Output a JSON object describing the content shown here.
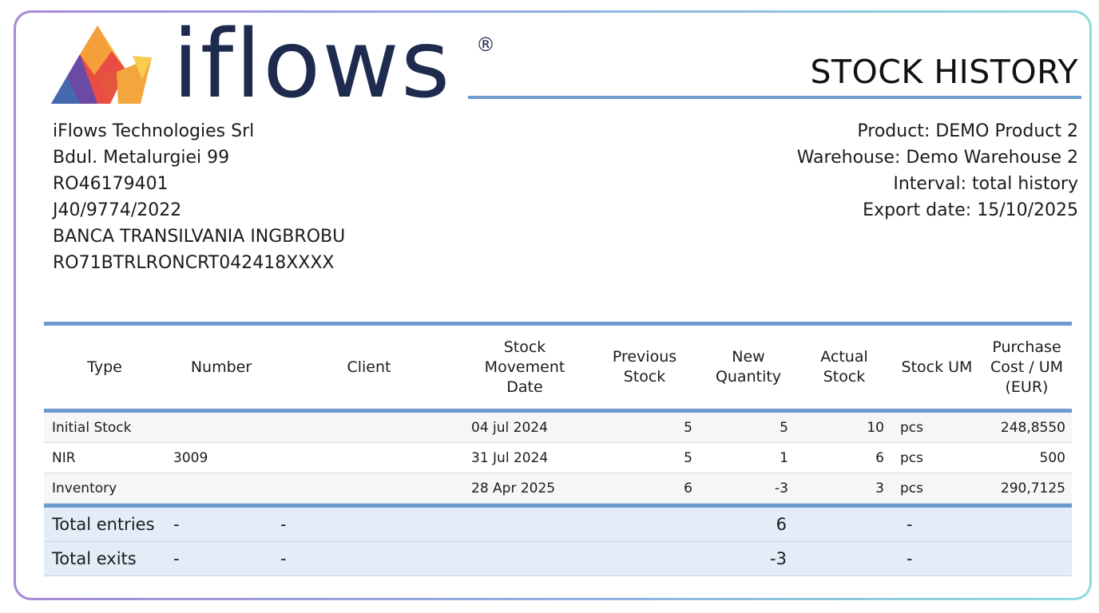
{
  "brand": {
    "wordmark": "iflows",
    "registered_mark": "®",
    "colors": {
      "navy": "#1e2b4f",
      "accent_blue": "#6d9bce",
      "total_row_bg": "#e3edf8"
    }
  },
  "document": {
    "title": "STOCK HISTORY"
  },
  "company": {
    "lines": [
      "iFlows Technologies Srl",
      "Bdul. Metalurgiei 99",
      "RO46179401",
      "J40/9774/2022",
      "BANCA TRANSILVANIA INGBROBU",
      "RO71BTRLRONCRT042418XXXX"
    ]
  },
  "meta": {
    "lines": [
      "Product: DEMO Product 2",
      "Warehouse: Demo Warehouse 2",
      "Interval: total history",
      "Export date: 15/10/2025"
    ]
  },
  "table": {
    "headers": {
      "type": "Type",
      "number": "Number",
      "client": "Client",
      "date_1": "Stock",
      "date_2": "Movement",
      "date_3": "Date",
      "prev_1": "Previous",
      "prev_2": "Stock",
      "newq_1": "New",
      "newq_2": "Quantity",
      "actual_1": "Actual",
      "actual_2": "Stock",
      "um": "Stock UM",
      "cost_1": "Purchase",
      "cost_2": "Cost / UM",
      "cost_3": "(EUR)"
    },
    "rows": [
      {
        "type": "Initial Stock",
        "number": "",
        "client": "",
        "date": "04 jul 2024",
        "previous": "5",
        "new_qty": "5",
        "actual": "10",
        "um": "pcs",
        "cost": "248,8550"
      },
      {
        "type": "NIR",
        "number": "3009",
        "client": "",
        "date": "31 Jul 2024",
        "previous": "5",
        "new_qty": "1",
        "actual": "6",
        "um": "pcs",
        "cost": "500"
      },
      {
        "type": "Inventory",
        "number": "",
        "client": "",
        "date": "28 Apr 2025",
        "previous": "6",
        "new_qty": "-3",
        "actual": "3",
        "um": "pcs",
        "cost": "290,7125"
      }
    ],
    "totals": [
      {
        "label": "Total entries",
        "number": "-",
        "client": "-",
        "value": "6",
        "um": "-"
      },
      {
        "label": "Total exits",
        "number": "-",
        "client": "-",
        "value": "-3",
        "um": "-"
      }
    ]
  }
}
